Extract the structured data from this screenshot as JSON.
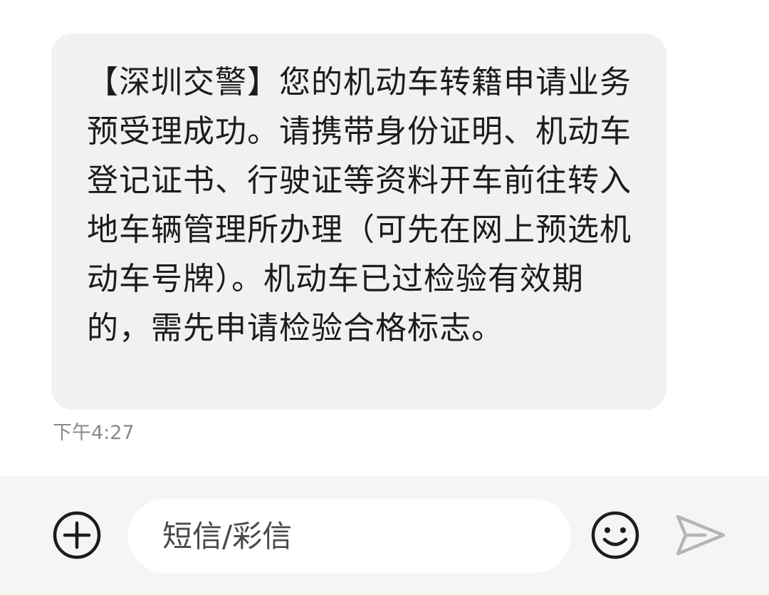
{
  "message": {
    "text": "【深圳交警】您的机动车转籍申请业务预受理成功。请携带身份证明、机动车登记证书、行驶证等资料开车前往转入地车辆管理所办理（可先在网上预选机动车号牌）。机动车已过检验有效期的，需先申请检验合格标志。",
    "time": "下午4:27"
  },
  "composer": {
    "placeholder": "短信/彩信"
  },
  "icons": {
    "add": "plus-circle-icon",
    "emoji": "smiley-icon",
    "send": "send-arrow-icon"
  },
  "colors": {
    "bubble": "#f1f1f1",
    "composer_bar": "#f5f5f5",
    "text": "#1c1c1c",
    "timestamp": "#8a8a8a",
    "send_disabled": "#b5b5b5"
  }
}
